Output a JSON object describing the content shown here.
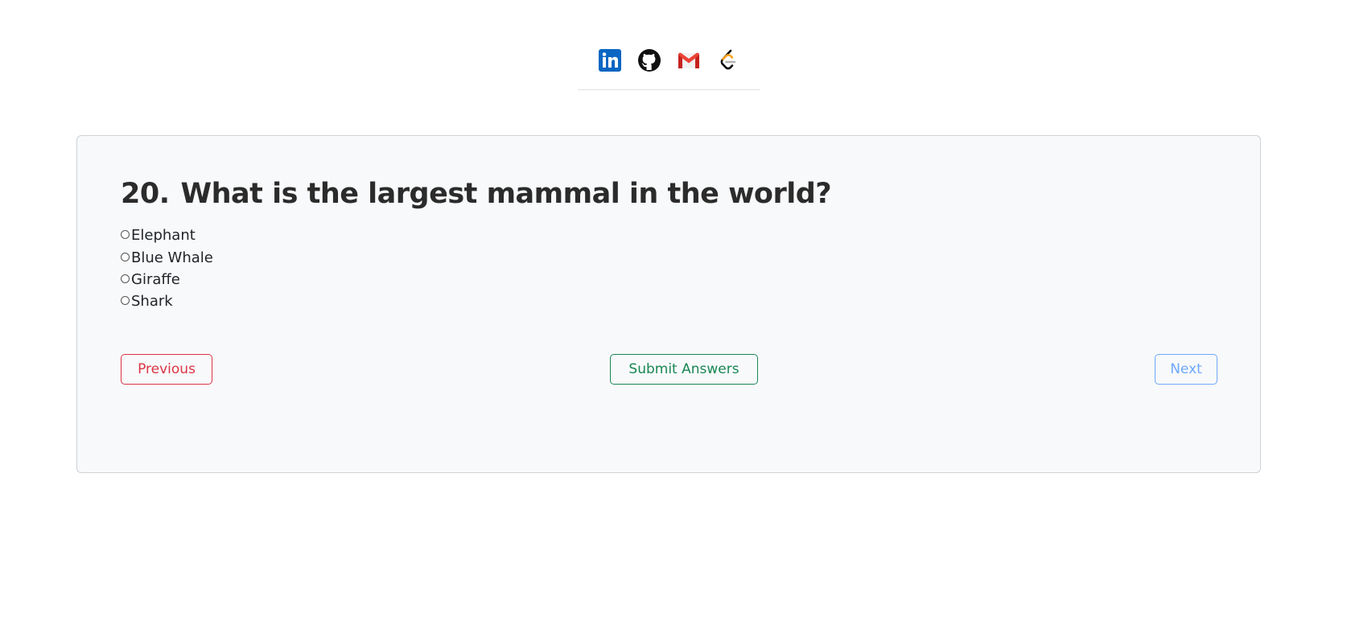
{
  "social": [
    {
      "name": "LinkedIn",
      "icon": "linkedin-icon",
      "color": "#0a66c2"
    },
    {
      "name": "GitHub",
      "icon": "github-icon",
      "color": "#111111"
    },
    {
      "name": "Gmail",
      "icon": "gmail-icon",
      "color": "#ea4335"
    },
    {
      "name": "LeetCode",
      "icon": "leetcode-icon",
      "color": "#ffa116"
    }
  ],
  "question": {
    "number": "20.",
    "text": "What is the largest mammal in the world?",
    "options": [
      "Elephant",
      "Blue Whale",
      "Giraffe",
      "Shark"
    ]
  },
  "buttons": {
    "previous": "Previous",
    "submit": "Submit Answers",
    "next": "Next"
  },
  "colors": {
    "previous": "#dc3545",
    "submit": "#198754",
    "next": "#6ea8fe",
    "card_bg": "#f8f9fa"
  }
}
